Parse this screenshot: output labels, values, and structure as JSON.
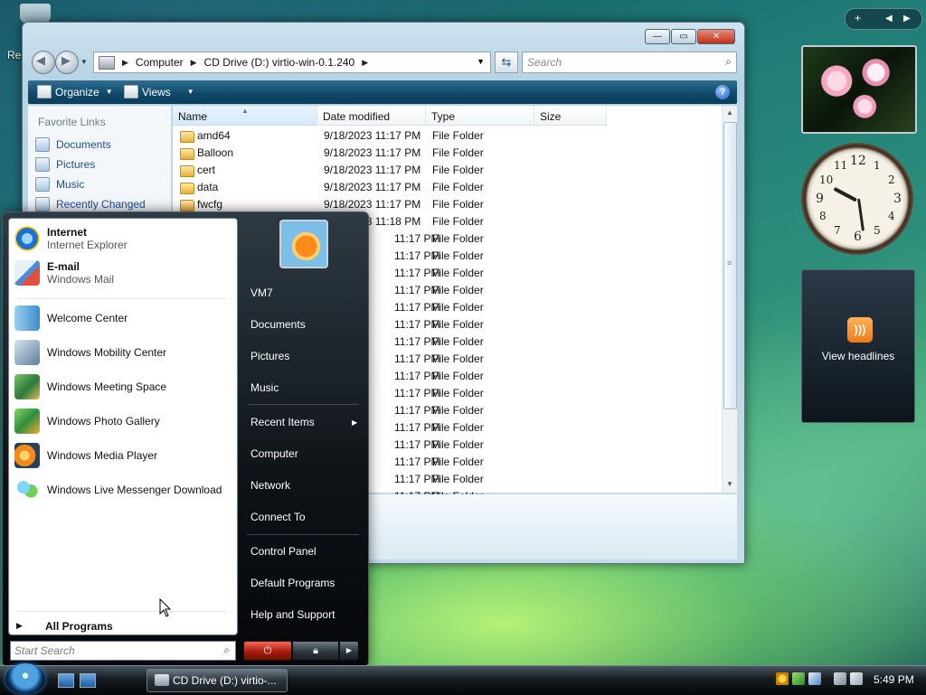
{
  "desktop": {
    "label": "Re"
  },
  "explorer": {
    "breadcrumb": [
      "Computer",
      "CD Drive (D:) virtio-win-0.1.240"
    ],
    "search_placeholder": "Search",
    "toolbar": {
      "organize": "Organize",
      "views": "Views"
    },
    "favorite_links_title": "Favorite Links",
    "favorite_links": [
      "Documents",
      "Pictures",
      "Music",
      "Recently Changed"
    ],
    "columns": [
      "Name",
      "Date modified",
      "Type",
      "Size"
    ],
    "rows": [
      {
        "name": "amd64",
        "date": "9/18/2023 11:17 PM",
        "type": "File Folder"
      },
      {
        "name": "Balloon",
        "date": "9/18/2023 11:17 PM",
        "type": "File Folder"
      },
      {
        "name": "cert",
        "date": "9/18/2023 11:17 PM",
        "type": "File Folder"
      },
      {
        "name": "data",
        "date": "9/18/2023 11:17 PM",
        "type": "File Folder"
      },
      {
        "name": "fwcfg",
        "date": "9/18/2023 11:17 PM",
        "type": "File Folder"
      },
      {
        "name": "",
        "date": "9/18/2023 11:18 PM",
        "type": "File Folder"
      },
      {
        "name": "",
        "date": "11:17 PM",
        "type": "File Folder"
      },
      {
        "name": "",
        "date": "11:17 PM",
        "type": "File Folder"
      },
      {
        "name": "",
        "date": "11:17 PM",
        "type": "File Folder"
      },
      {
        "name": "",
        "date": "11:17 PM",
        "type": "File Folder"
      },
      {
        "name": "",
        "date": "11:17 PM",
        "type": "File Folder"
      },
      {
        "name": "",
        "date": "11:17 PM",
        "type": "File Folder"
      },
      {
        "name": "",
        "date": "11:17 PM",
        "type": "File Folder"
      },
      {
        "name": "",
        "date": "11:17 PM",
        "type": "File Folder"
      },
      {
        "name": "",
        "date": "11:17 PM",
        "type": "File Folder"
      },
      {
        "name": "",
        "date": "11:17 PM",
        "type": "File Folder"
      },
      {
        "name": "",
        "date": "11:17 PM",
        "type": "File Folder"
      },
      {
        "name": "",
        "date": "11:17 PM",
        "type": "File Folder"
      },
      {
        "name": "",
        "date": "11:17 PM",
        "type": "File Folder"
      },
      {
        "name": "",
        "date": "11:17 PM",
        "type": "File Folder"
      },
      {
        "name": "",
        "date": "11:17 PM",
        "type": "File Folder"
      },
      {
        "name": "",
        "date": "11:17 PM",
        "type": "File Folder"
      }
    ]
  },
  "start_menu": {
    "pinned": [
      {
        "title": "Internet",
        "subtitle": "Internet Explorer",
        "icon": "internet-explorer-icon"
      },
      {
        "title": "E-mail",
        "subtitle": "Windows Mail",
        "icon": "windows-mail-icon"
      }
    ],
    "recent": [
      {
        "label": "Welcome Center",
        "icon": "welcome-center-icon"
      },
      {
        "label": "Windows Mobility Center",
        "icon": "mobility-center-icon"
      },
      {
        "label": "Windows Meeting Space",
        "icon": "meeting-space-icon"
      },
      {
        "label": "Windows Photo Gallery",
        "icon": "photo-gallery-icon"
      },
      {
        "label": "Windows Media Player",
        "icon": "media-player-icon"
      },
      {
        "label": "Windows Live Messenger Download",
        "icon": "messenger-icon"
      }
    ],
    "all_programs": "All Programs",
    "search_placeholder": "Start Search",
    "right_links": [
      "VM7",
      "Documents",
      "Pictures",
      "Music",
      "Recent Items",
      "Computer",
      "Network",
      "Connect To",
      "Control Panel",
      "Default Programs",
      "Help and Support"
    ]
  },
  "gadgets": {
    "feed_label": "View headlines"
  },
  "taskbar": {
    "task_label": "CD Drive (D:) virtio-...",
    "time": "5:49 PM"
  },
  "colors": {
    "link": "#1a4fa0",
    "toolbar": "#0f4a6a",
    "start_menu_bg": "#0e1216"
  }
}
